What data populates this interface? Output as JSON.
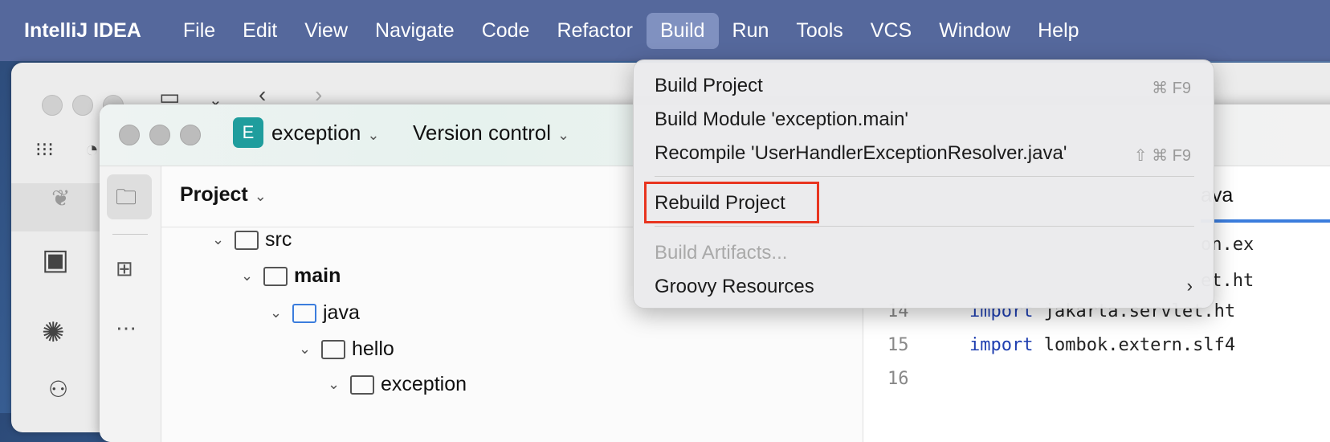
{
  "menubar": {
    "app": "IntelliJ IDEA",
    "items": [
      "File",
      "Edit",
      "View",
      "Navigate",
      "Code",
      "Refactor",
      "Build",
      "Run",
      "Tools",
      "VCS",
      "Window",
      "Help"
    ]
  },
  "window": {
    "project_badge": "E",
    "project_name": "exception",
    "vcs_label": "Version control",
    "panel_title": "Project"
  },
  "tree": [
    {
      "label": "src"
    },
    {
      "label": "main"
    },
    {
      "label": "java"
    },
    {
      "label": "hello"
    },
    {
      "label": "exception"
    }
  ],
  "editor": {
    "tab_fragment": "ava",
    "lines": [
      {
        "num": "",
        "code": "on.ex"
      },
      {
        "num": "",
        "code": "et.ht"
      },
      {
        "num": "14",
        "kw": "import",
        "code": " jakarta.servlet.ht"
      },
      {
        "num": "15",
        "kw": "import",
        "code": " lombok.extern.slf4"
      },
      {
        "num": "16",
        "code": ""
      }
    ]
  },
  "build_menu": {
    "items": [
      {
        "label": "Build Project",
        "shortcut": "⌘ F9"
      },
      {
        "label": "Build Module 'exception.main'",
        "shortcut": ""
      },
      {
        "label": "Recompile 'UserHandlerExceptionResolver.java'",
        "shortcut": "⇧ ⌘ F9"
      },
      {
        "label": "Rebuild Project",
        "shortcut": ""
      },
      {
        "label": "Build Artifacts...",
        "shortcut": ""
      },
      {
        "label": "Groovy Resources",
        "shortcut": ""
      }
    ]
  },
  "colors": {
    "highlight": "#e8341f",
    "accent": "#3b7ddd",
    "badge": "#1f9d9d"
  }
}
